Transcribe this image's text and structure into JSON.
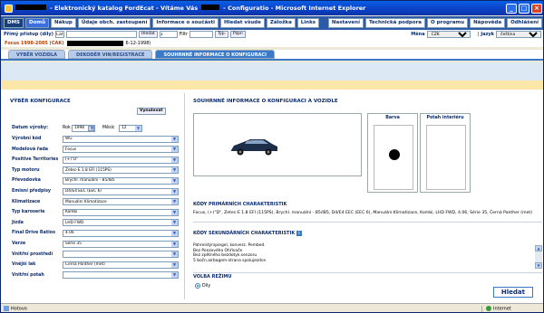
{
  "window": {
    "title_prefix": "- Elektronický katalog FordEcat - Vítáme Vás",
    "title_suffix": "- Configuratio - Microsoft Internet Explorer"
  },
  "nav": {
    "logo": "DMS",
    "items": [
      "Domů",
      "Nákup",
      "Údaje obch. zastoupení",
      "Informace o součásti",
      "Hledat všude",
      "Záložka",
      "Links"
    ],
    "right_items": [
      "Nastavení",
      "Technická podpora",
      "O programu",
      "Nápověda",
      "Odhlášení"
    ]
  },
  "quick_access": {
    "label": "Přímý přístup (díly)",
    "value": "Cat",
    "search_button": "Hledat",
    "page": "1",
    "filter_label": "Filtr",
    "pill1": "Týp.",
    "pill2": "Pzpn",
    "currency_label": "Měna",
    "currency_value": "CZK",
    "language_label": "Jazyk",
    "language_value": "čeština"
  },
  "vehicle_line": {
    "model": "Focus 1998-2005 (CAK)",
    "date_fragment": "6-12-1998)"
  },
  "tabs": [
    "VÝBĚR VOZIDLA",
    "DEKODÉR VIN/REGISTRACE",
    "SOUHRNNÉ INFORMACE O KONFIGURACI"
  ],
  "left": {
    "heading": "VÝBĚR KONFIGURACE",
    "reset_button": "Vynulovat",
    "date_label": "Datum výroby:",
    "year_label": "Rok",
    "year_value": "1998",
    "month_label": "Měsíc",
    "month_value": "12",
    "fields": [
      {
        "label": "Výrobní kód",
        "value": "WG"
      },
      {
        "label": "Modelová řada",
        "value": "Focus"
      },
      {
        "label": "Positive Territories",
        "value": "(+)\"D\""
      },
      {
        "label": "Typ motoru",
        "value": "Zetec-E 1.8 EFI (115PS)"
      },
      {
        "label": "Převodovka",
        "value": "Brychl. manuální - B5/IB5"
      },
      {
        "label": "Emisní předpisy",
        "value": "D4/E4 EEC (EEC 6)"
      },
      {
        "label": "Klimatizace",
        "value": "Manuální Klimatizace"
      },
      {
        "label": "Typ karoserie",
        "value": "Kombi"
      },
      {
        "label": "Jízda",
        "value": "LHD FWD"
      },
      {
        "label": "Final Drive Ratios",
        "value": "4.06"
      },
      {
        "label": "Verze",
        "value": "Série 35"
      },
      {
        "label": "Vnitřní prostředí",
        "value": ""
      },
      {
        "label": "Vnější lak",
        "value": "Černá Panther (met)"
      },
      {
        "label": "Vnitřní potah",
        "value": ""
      }
    ]
  },
  "right": {
    "heading": "SOUHRNNÉ INFORMACE O KONFIGURACI A VOZIDLE",
    "color_label": "Barva",
    "interior_label": "Potah interiéru",
    "primary_heading": "KÓDY PRIMÁRNÍCH CHARAKTERISTIK",
    "primary_text": "Focus, (+)\"D\", Zetec-E 1.8 EFI (115PS), Brychl. manuální - B5/IB5, D4/E4 EEC (EEC 6), Manuální Klimatizace, Kombi, LHD FWD, 4.06, Série 35, Černá Panther (met)",
    "secondary_heading": "KÓDY SEKUNDÁRNÍCH CHARAKTERISTIK",
    "secondary_lines": [
      "Pahreistýrspiegel, konverz. Pembed.",
      "Bez Ponzového Ohřívače",
      "Bez zpětného bezdotyk.senzoru",
      "5 bočn.airbagem-strana spolujezdce"
    ],
    "mode_heading": "VOLBA REŽIMU",
    "mode_option": "Díly",
    "search_button": "Hledat"
  },
  "status": {
    "left": "Hotovo",
    "zone": "Internet"
  }
}
